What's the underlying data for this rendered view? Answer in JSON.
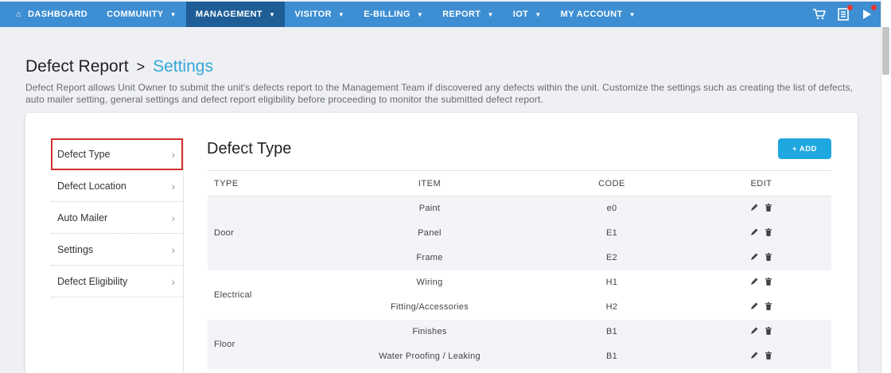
{
  "nav": {
    "items": [
      {
        "label": "DASHBOARD",
        "icon": "home-icon",
        "caret": false,
        "active": false
      },
      {
        "label": "COMMUNITY",
        "caret": true,
        "active": false
      },
      {
        "label": "MANAGEMENT",
        "caret": true,
        "active": true
      },
      {
        "label": "VISITOR",
        "caret": true,
        "active": false
      },
      {
        "label": "E-BILLING",
        "caret": true,
        "active": false
      },
      {
        "label": "REPORT",
        "caret": true,
        "active": false
      },
      {
        "label": "IOT",
        "caret": true,
        "active": false
      },
      {
        "label": "MY ACCOUNT",
        "caret": true,
        "active": false
      }
    ],
    "right_icons": [
      "cart-icon",
      "notes-icon",
      "bell-icon"
    ]
  },
  "breadcrumb": {
    "root": "Defect Report",
    "separator": ">",
    "current": "Settings"
  },
  "description": "Defect Report allows Unit Owner to submit the unit's defects report to the Management Team if discovered any defects within the unit. Customize the settings such as creating the list of defects, auto mailer setting, general settings and defect report eligibility before proceeding to monitor the submitted defect report.",
  "side_menu": [
    {
      "label": "Defect Type",
      "selected": true
    },
    {
      "label": "Defect Location",
      "selected": false
    },
    {
      "label": "Auto Mailer",
      "selected": false
    },
    {
      "label": "Settings",
      "selected": false
    },
    {
      "label": "Defect Eligibility",
      "selected": false
    }
  ],
  "content": {
    "title": "Defect Type",
    "add_label": "+ ADD",
    "columns": [
      "TYPE",
      "ITEM",
      "CODE",
      "EDIT"
    ],
    "groups": [
      {
        "type": "Door",
        "rows": [
          {
            "item": "Paint",
            "code": "e0"
          },
          {
            "item": "Panel",
            "code": "E1"
          },
          {
            "item": "Frame",
            "code": "E2"
          }
        ]
      },
      {
        "type": "Electrical",
        "rows": [
          {
            "item": "Wiring",
            "code": "H1"
          },
          {
            "item": "Fitting/Accessories",
            "code": "H2"
          }
        ]
      },
      {
        "type": "Floor",
        "rows": [
          {
            "item": "Finishes",
            "code": "B1"
          },
          {
            "item": "Water Proofing / Leaking",
            "code": "B1"
          }
        ]
      }
    ]
  },
  "colors": {
    "nav_bg": "#3d8ed2",
    "nav_active": "#1e5d96",
    "accent": "#35a8d8",
    "add_button": "#1fa8e0",
    "selection_outline": "#d32f2f",
    "badge": "#e53935"
  }
}
